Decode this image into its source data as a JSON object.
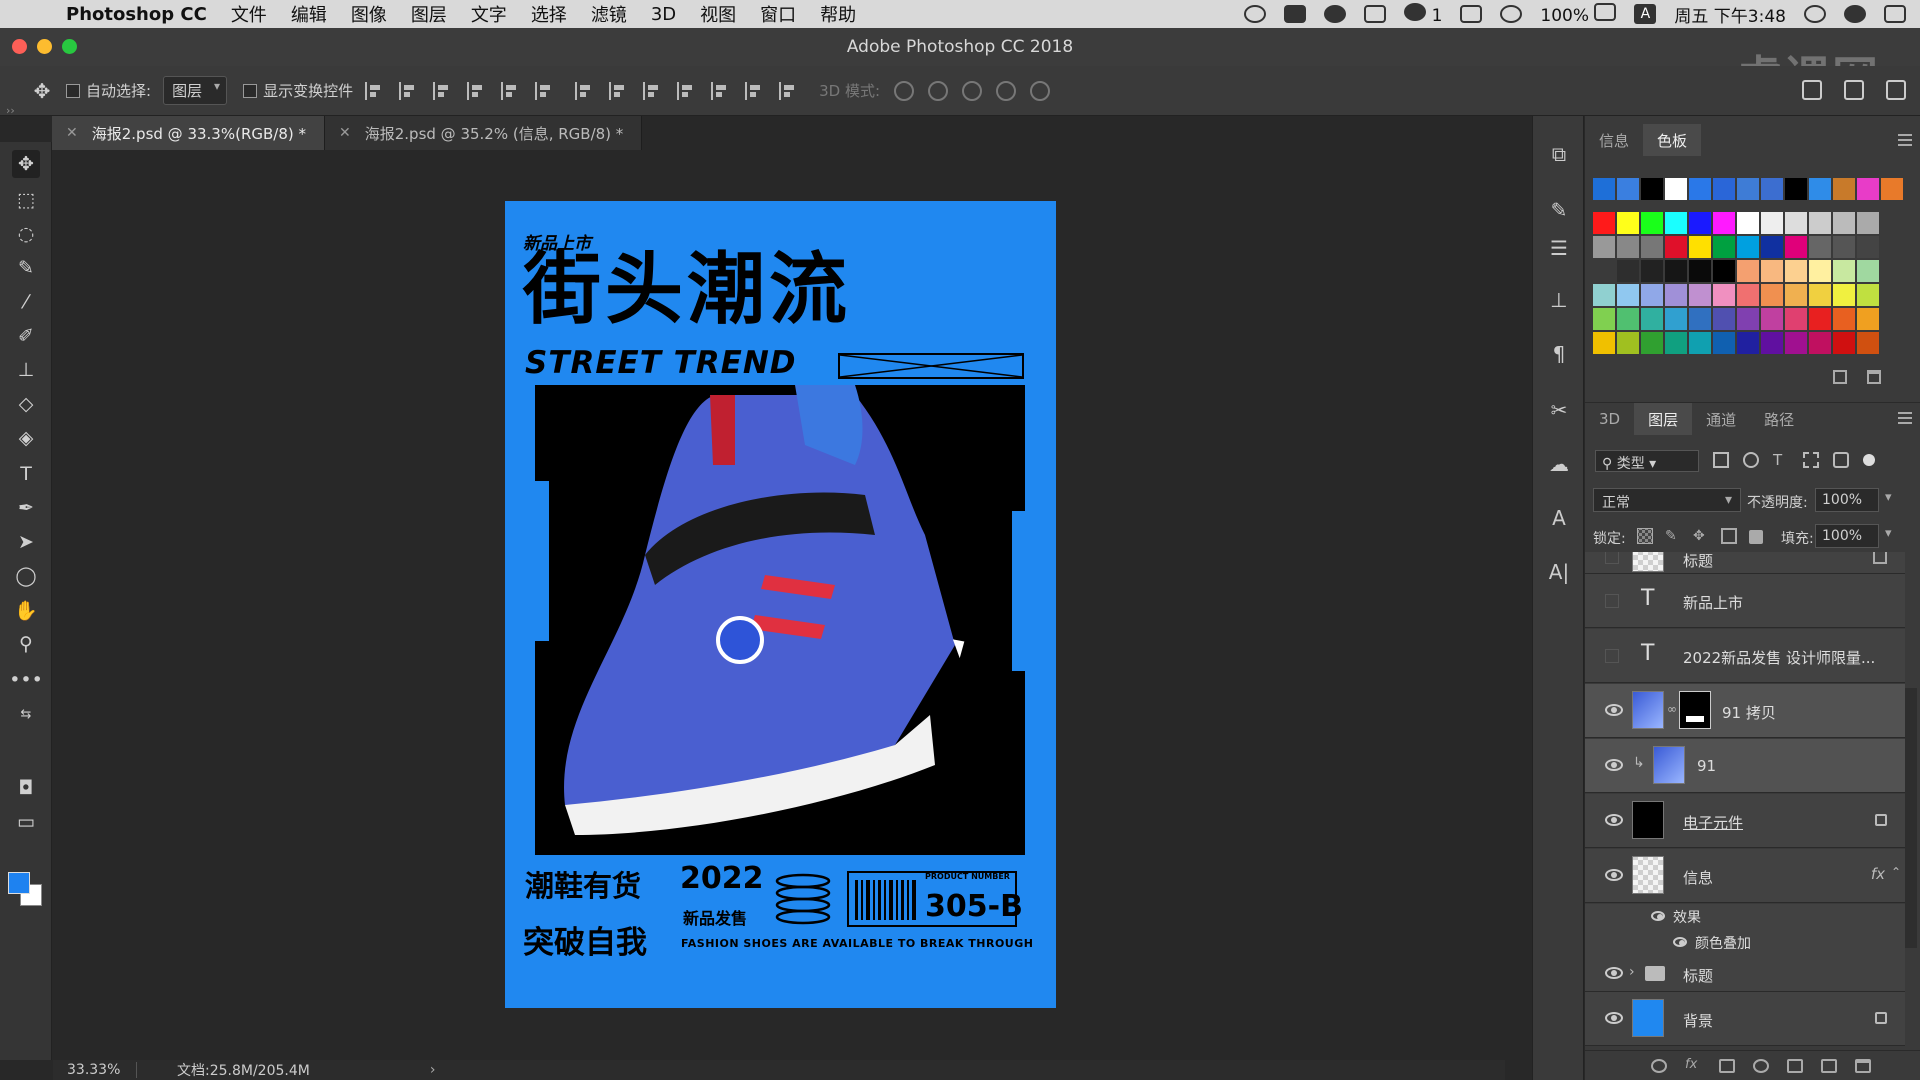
{
  "menubar": {
    "app": "Photoshop CC",
    "items": [
      "文件",
      "编辑",
      "图像",
      "图层",
      "文字",
      "选择",
      "滤镜",
      "3D",
      "视图",
      "窗口",
      "帮助"
    ],
    "wechat_count": "1",
    "battery": "100%",
    "input": "A",
    "clock": "周五 下午3:48"
  },
  "titlebar": {
    "title": "Adobe Photoshop CC 2018",
    "watermark": "虎课网"
  },
  "options": {
    "auto_select_label": "自动选择:",
    "auto_select_value": "图层",
    "transform_label": "显示变换控件",
    "mode3d_label": "3D 模式:"
  },
  "tabs": [
    {
      "label": "海报2.psd @ 33.3%(RGB/8) *"
    },
    {
      "label": "海报2.psd @ 35.2% (信息, RGB/8) *"
    }
  ],
  "poster": {
    "tag": "新品上市",
    "title_cn": "街头潮流",
    "title_en": "STREET TREND",
    "bottom_cn1": "潮鞋有货",
    "year": "2022",
    "sub": "新品发售",
    "bottom_cn2": "突破自我",
    "product_label": "PRODUCT NUMBER",
    "code": "305-B",
    "footer": "FASHION SHOES ARE AVAILABLE TO BREAK THROUGH"
  },
  "status": {
    "zoom": "33.33%",
    "doc": "文档:25.8M/205.4M",
    "arrow": "›"
  },
  "panels": {
    "top_tabs": [
      "信息",
      "色板"
    ],
    "layer_tabs": [
      "3D",
      "图层",
      "通道",
      "路径"
    ],
    "filter_label": "类型",
    "blend_mode": "正常",
    "opacity_label": "不透明度:",
    "opacity": "100%",
    "lock_label": "锁定:",
    "fill_label": "填充:",
    "fill": "100%"
  },
  "layers": [
    {
      "name": "标题",
      "kind": "partial"
    },
    {
      "name": "新品上市",
      "kind": "text"
    },
    {
      "name": "2022新品发售 设计师限量...",
      "kind": "text"
    },
    {
      "name": "91 拷贝",
      "kind": "masked"
    },
    {
      "name": "91",
      "kind": "clipped"
    },
    {
      "name": "电子元件",
      "kind": "locked"
    },
    {
      "name": "信息",
      "kind": "fx",
      "fx": "fx"
    },
    {
      "name": "效果",
      "kind": "effect-header"
    },
    {
      "name": "颜色叠加",
      "kind": "effect"
    },
    {
      "name": "标题",
      "kind": "group"
    },
    {
      "name": "背景",
      "kind": "background"
    }
  ],
  "swatches": {
    "recent": [
      "#1e6fd8",
      "#3a7fe0",
      "#000000",
      "#ffffff",
      "#2a78e8",
      "#2a66d8",
      "#3e7cd6",
      "#3c6ed0",
      "#000000",
      "#2f8ce8",
      "#c87a2a",
      "#e83cc8",
      "#e87a2a"
    ],
    "rows": [
      [
        "#ff1a1a",
        "#ffff1a",
        "#1aff1a",
        "#1affff",
        "#1a1aff",
        "#ff1aff",
        "#ffffff",
        "#eeeeee",
        "#dddddd",
        "#cccccc",
        "#bbbbbb",
        "#aaaaaa"
      ],
      [
        "#999999",
        "#888888",
        "#777777",
        "#e0102a",
        "#ffe000",
        "#00a040",
        "#00a0e0",
        "#1030a0",
        "#e0007a",
        "#666666",
        "#555555",
        "#444444"
      ],
      [
        "#3a3a3a",
        "#2e2e2e",
        "#222222",
        "#161616",
        "#0a0a0a",
        "#000000",
        "#f4a070",
        "#f8b880",
        "#fcd090",
        "#fff0a0",
        "#c8e8a0",
        "#a0d8a0"
      ],
      [
        "#90d0d0",
        "#90c8f0",
        "#90a8e8",
        "#a090d8",
        "#c090d0",
        "#f090c0",
        "#f07070",
        "#f09050",
        "#f0b050",
        "#f0d040",
        "#f0f040",
        "#c0e040"
      ],
      [
        "#80d050",
        "#50c070",
        "#30b0a0",
        "#30a0d0",
        "#3070c0",
        "#5050b0",
        "#8040b0",
        "#c040a0",
        "#e04070",
        "#e82020",
        "#e86020",
        "#f0a020"
      ],
      [
        "#f0c000",
        "#a0c020",
        "#30a030",
        "#10a080",
        "#10a0b0",
        "#1060b0",
        "#2020a0",
        "#6010a0",
        "#a01090",
        "#c01060",
        "#d01010",
        "#d05010"
      ]
    ]
  }
}
